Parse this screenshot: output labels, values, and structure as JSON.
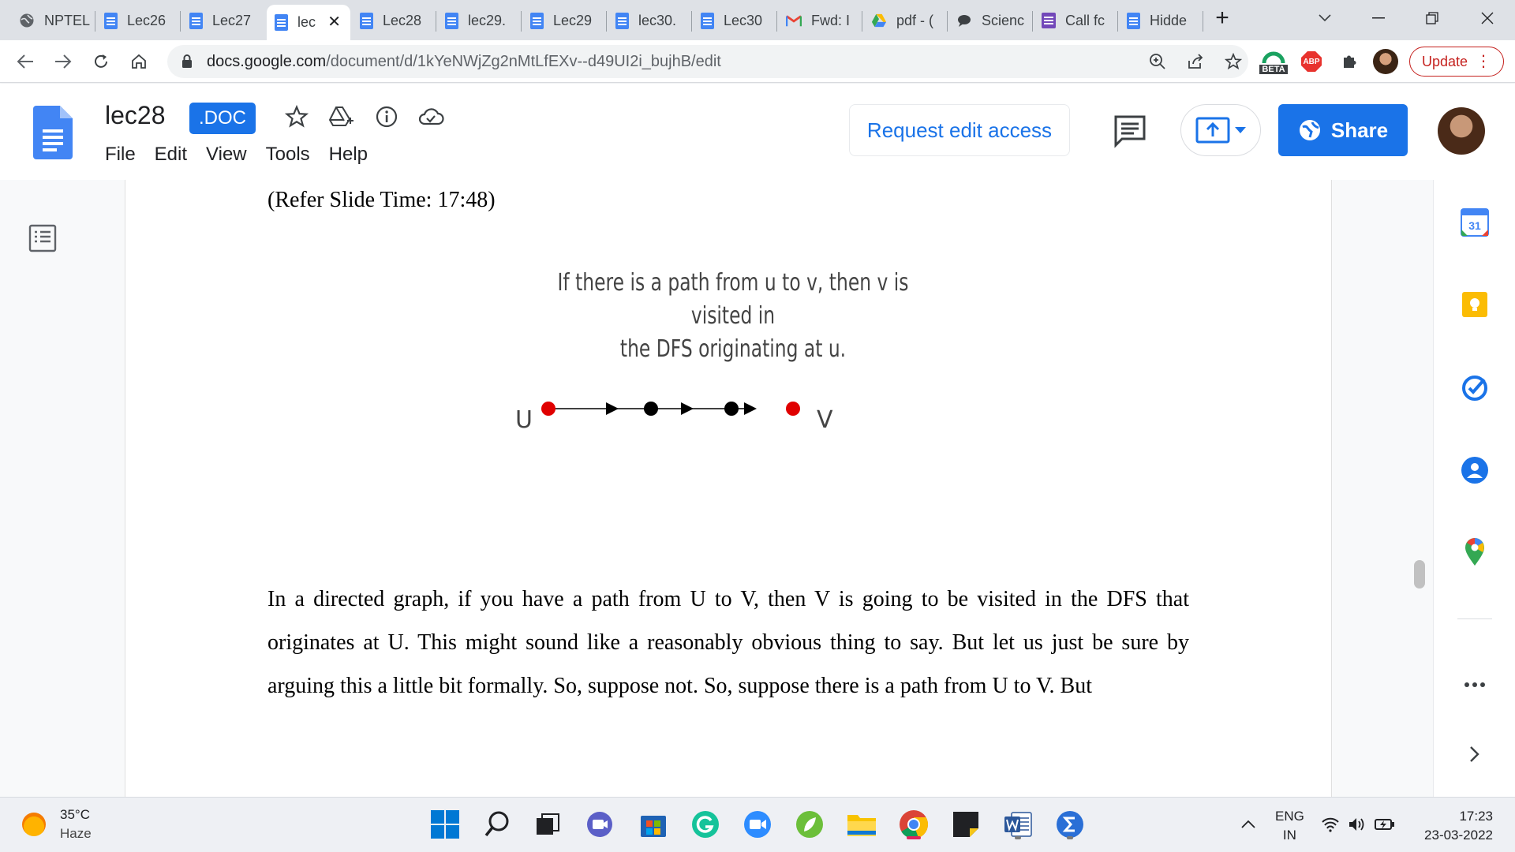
{
  "browser": {
    "tabs": [
      {
        "title": "NPTEL",
        "icon": "globe-icon",
        "active": false
      },
      {
        "title": "Lec26",
        "icon": "docs-icon",
        "active": false
      },
      {
        "title": "Lec27",
        "icon": "docs-icon",
        "active": false
      },
      {
        "title": "lec",
        "icon": "docs-icon",
        "active": true
      },
      {
        "title": "Lec28",
        "icon": "docs-icon",
        "active": false
      },
      {
        "title": "lec29.",
        "icon": "docs-icon",
        "active": false
      },
      {
        "title": "Lec29",
        "icon": "docs-icon",
        "active": false
      },
      {
        "title": "lec30.",
        "icon": "docs-icon",
        "active": false
      },
      {
        "title": "Lec30",
        "icon": "docs-icon",
        "active": false
      },
      {
        "title": "Fwd: I",
        "icon": "gmail-icon",
        "active": false
      },
      {
        "title": "pdf - (",
        "icon": "drive-icon",
        "active": false
      },
      {
        "title": "Scienc",
        "icon": "chat-bubble-icon",
        "active": false
      },
      {
        "title": "Call fc",
        "icon": "sheets-icon",
        "active": false
      },
      {
        "title": "Hidde",
        "icon": "docs-icon",
        "active": false
      }
    ],
    "url_host": "docs.google.com",
    "url_path": "/document/d/1kYeNWjZg2nMtLfEXv--d49UI2i_bujhB/edit",
    "beta_label": "BETA",
    "abp_label": "ABP",
    "update_label": "Update"
  },
  "docs": {
    "title": "lec28",
    "badge": ".DOC",
    "menu": [
      "File",
      "Edit",
      "View",
      "Tools",
      "Help"
    ],
    "request_edit_label": "Request edit access",
    "share_label": "Share",
    "accent": "#1a73e8"
  },
  "document": {
    "slide_time": "(Refer Slide Time: 17:48)",
    "slide_caption_line1": "If there is a path from u to v, then v is visited in",
    "slide_caption_line2": "the DFS originating at u.",
    "label_u": "U",
    "label_v": "V",
    "body": "In a directed graph, if you have a path from U to V, then V is going to be visited in the DFS that originates at U. This might sound like a reasonably obvious thing to say. But let us just be sure by arguing this a little bit formally. So, suppose not. So, suppose there is a path from U to V. But",
    "node_colors": {
      "endpoint": "#e00000",
      "middle": "#000000"
    }
  },
  "side_panel": {
    "calendar_day": "31",
    "icons": [
      "calendar-icon",
      "keep-icon",
      "tasks-icon",
      "contacts-icon",
      "maps-icon",
      "more-icon",
      "expand-icon"
    ]
  },
  "taskbar": {
    "temperature": "35°C",
    "condition": "Haze",
    "lang_line1": "ENG",
    "lang_line2": "IN",
    "time": "17:23",
    "date": "23-03-2022"
  }
}
